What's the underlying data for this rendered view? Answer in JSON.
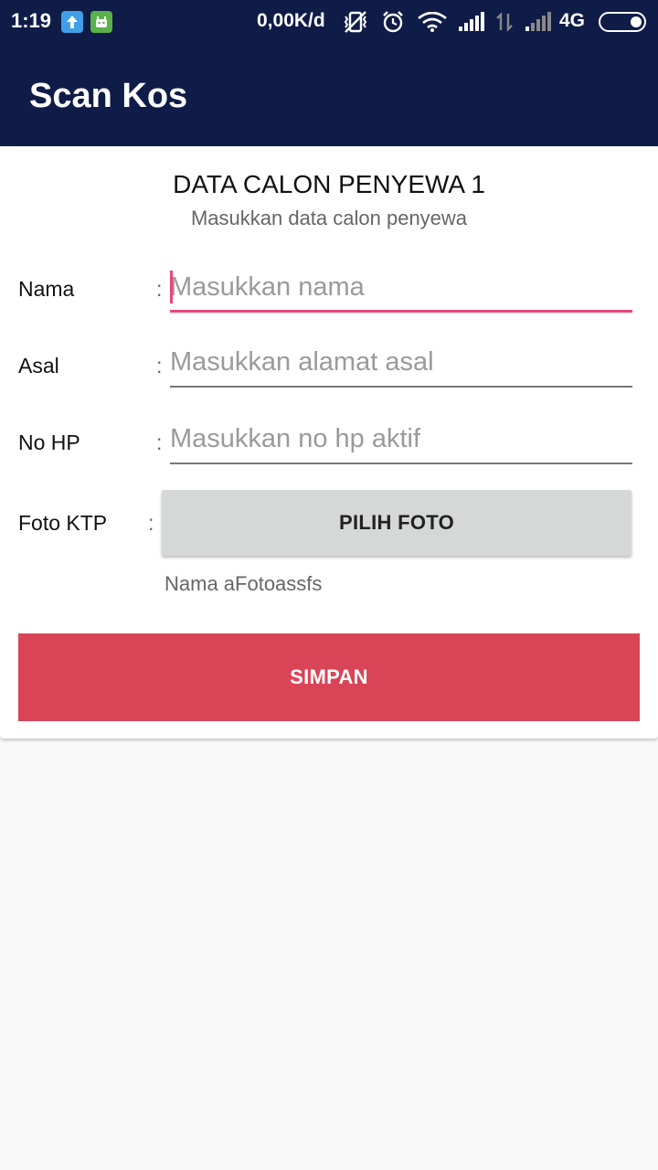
{
  "status_bar": {
    "time": "1:19",
    "net_speed": "0,00K/d",
    "network_type": "4G",
    "icons": [
      "upload-notification-icon",
      "android-app-icon",
      "vibrate-icon",
      "alarm-icon",
      "wifi-icon",
      "signal-icon",
      "data-arrows-icon",
      "signal-icon",
      "battery-icon"
    ]
  },
  "app_bar": {
    "title": "Scan Kos"
  },
  "form": {
    "title": "DATA CALON PENYEWA 1",
    "subtitle": "Masukkan data calon penyewa",
    "fields": [
      {
        "label": "Nama",
        "colon": ":",
        "value": "",
        "placeholder": "Masukkan nama"
      },
      {
        "label": "Asal",
        "colon": ":",
        "value": "",
        "placeholder": "Masukkan alamat asal"
      },
      {
        "label": "No HP",
        "colon": ":",
        "value": "",
        "placeholder": "Masukkan no hp aktif"
      }
    ],
    "photo": {
      "label": "Foto KTP",
      "colon": ":",
      "button": "PILIH FOTO",
      "filename": "Nama aFotoassfs"
    },
    "save_button": "SIMPAN"
  },
  "colors": {
    "primary_dark": "#0f1c47",
    "accent": "#ee4477",
    "save_button": "#da4457",
    "photo_button": "#d6d7d7"
  }
}
